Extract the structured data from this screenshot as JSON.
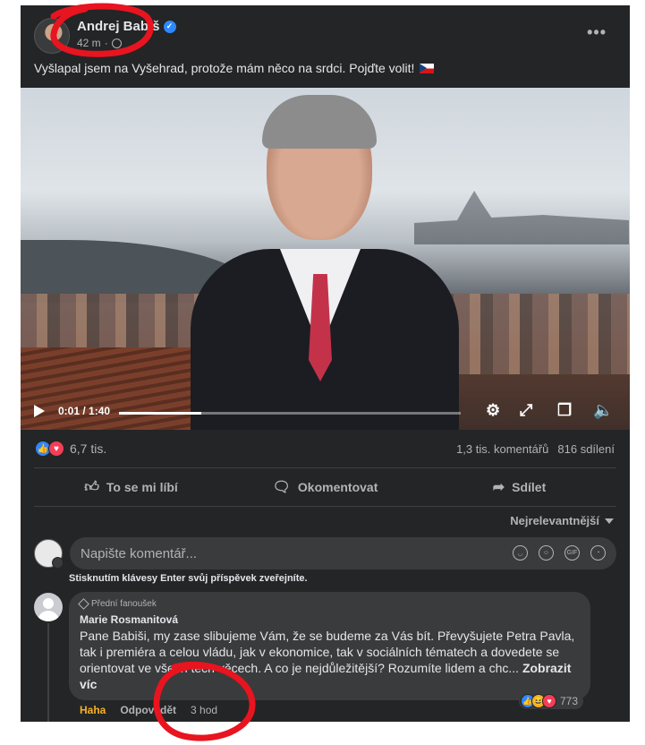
{
  "post": {
    "author": "Andrej Babiš",
    "time": "42 m",
    "more_label": "•••",
    "text": "Vyšlapal jsem na Vyšehrad, protože mám něco na srdci. Pojďte volit!"
  },
  "video": {
    "current_time": "0:01 / 1:40",
    "progress": 0.24
  },
  "stats": {
    "reaction_count": "6,7 tis.",
    "comments": "1,3 tis. komentářů",
    "shares": "816 sdílení"
  },
  "actions": {
    "like": "To se mi líbí",
    "comment": "Okomentovat",
    "share": "Sdílet"
  },
  "sort": {
    "label": "Nejrelevantnější"
  },
  "composer": {
    "placeholder": "Napište komentář...",
    "hint": "Stisknutím klávesy Enter svůj příspěvek zveřejníte."
  },
  "comment": {
    "badge": "Přední fanoušek",
    "name": "Marie Rosmanitová",
    "text": "Pane Babiši, my zase slibujeme Vám, že se budeme za Vás bít. Převyšujete Petra Pavla, tak i premiéra a celou vládu, jak v ekonomice, tak v sociálních tématech a dovedete se orientovat ve všech těch věcech. A co je nejdůležitější? Rozumíte lidem a chc...",
    "more": "Zobrazit víc",
    "reaction_count": "773",
    "haha": "Haha",
    "reply": "Odpovědět",
    "time": "3 hod"
  },
  "colors": {
    "card_bg": "#242526",
    "input_bg": "#3a3b3c",
    "accent": "#2d88ff",
    "love": "#f33e58",
    "haha": "#f7b125",
    "annotation": "#e8141f"
  }
}
